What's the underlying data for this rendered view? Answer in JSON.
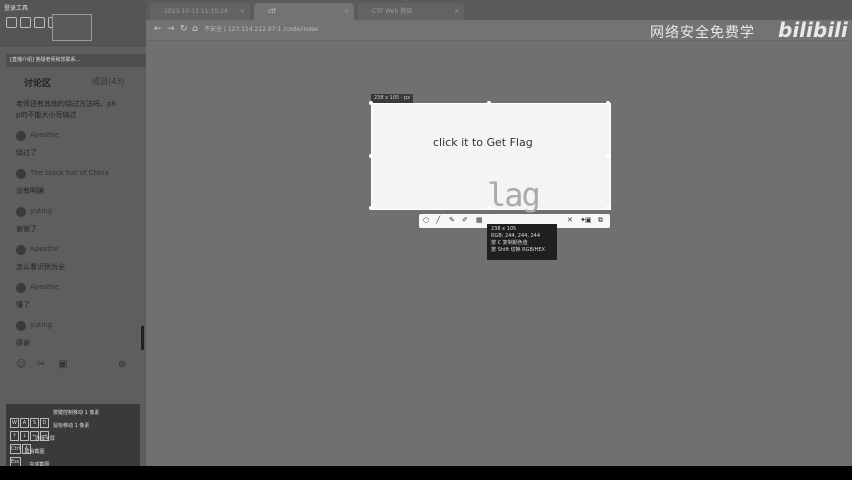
{
  "left_panel": {
    "title": "登录工具",
    "notice": "[直播介绍] 答疑老师和您联系...",
    "tab_discussion": "讨论区",
    "tab_members": "成员(43)",
    "messages": [
      {
        "type": "text",
        "text": "老师还有其他的绕过方法吗，ph"
      },
      {
        "type": "text",
        "text": "p的不能大小写绕过"
      },
      {
        "type": "user",
        "name": "Apesthe"
      },
      {
        "type": "text",
        "text": "绕过了"
      },
      {
        "type": "user",
        "name": "The black hat of China"
      },
      {
        "type": "text",
        "text": "没有明确"
      },
      {
        "type": "user",
        "name": "yuting"
      },
      {
        "type": "text",
        "text": "谢谢了"
      },
      {
        "type": "user",
        "name": "Apesthe"
      },
      {
        "type": "text",
        "text": "怎么看识别为全"
      },
      {
        "type": "user",
        "name": "Apesthe"
      },
      {
        "type": "text",
        "text": "懂了"
      },
      {
        "type": "user",
        "name": "yuting"
      },
      {
        "type": "text",
        "text": "感谢"
      }
    ],
    "shortcuts": [
      {
        "keys": [
          "W",
          "A",
          "S",
          "D"
        ],
        "desc": "按键控制移动 1 像素"
      },
      {
        "keys": [
          "↑",
          "↓",
          "←",
          "→"
        ],
        "desc": "鼠标移动 1 像素"
      },
      {
        "keys": [
          "Ctrl",
          "A"
        ],
        "desc": "选择全屏"
      },
      {
        "keys": [
          "Esc"
        ],
        "desc": "取消截图"
      },
      {
        "keys": [
          "Enter"
        ],
        "desc": "完成截图"
      }
    ]
  },
  "browser": {
    "tabs": [
      {
        "label": "2023-10-13 11:19:24",
        "active": false
      },
      {
        "label": "ctf",
        "active": true
      },
      {
        "label": "CTF Web 题目",
        "active": false
      }
    ],
    "url": "不安全 | 123.114.212.87:1 /code/index"
  },
  "page": {
    "button_text": "click it to Get Flag",
    "size_label": "238 x 105 · px",
    "captcha": "lag"
  },
  "magnifier": {
    "lines": [
      "238 x 105",
      "RGB: 244, 244, 244",
      "按 C 复制颜色值",
      "按 Shift 切换 RGB/HEX"
    ]
  },
  "watermark": {
    "text": "网络安全免费学",
    "logo": "bilibili"
  }
}
